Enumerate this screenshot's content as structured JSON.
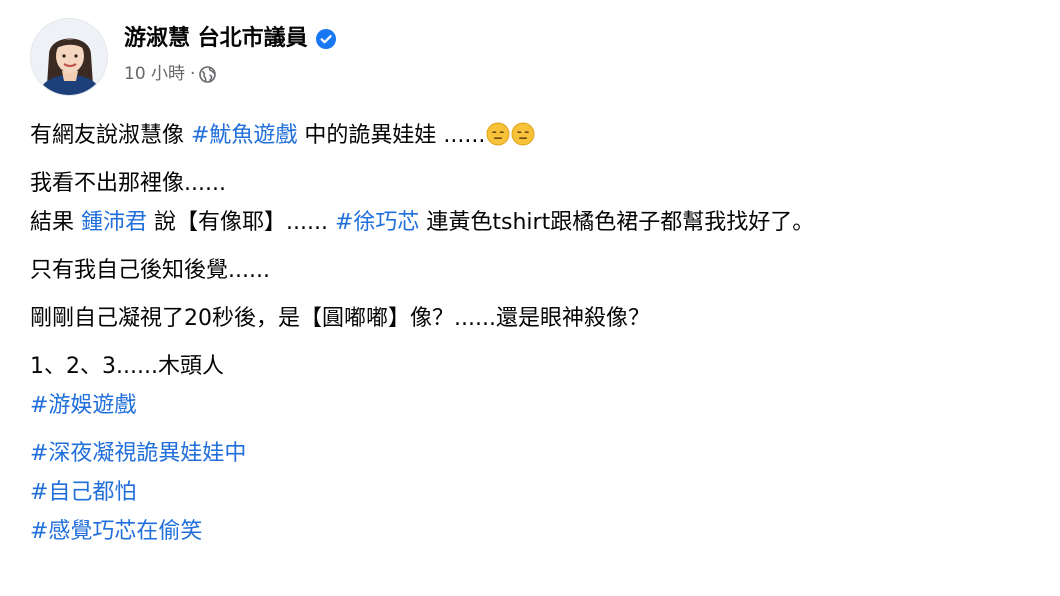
{
  "author": {
    "name": "游淑慧 台北市議員",
    "time": "10 小時",
    "separator": "·"
  },
  "post": {
    "line1": {
      "before": "有網友說淑慧像 ",
      "tag": "#魷魚遊戲",
      "after": "  中的詭異娃娃 ......"
    },
    "line2": "我看不出那裡像......",
    "line3": {
      "before": "結果 ",
      "mention1": "鍾沛君",
      "middle": "  說【有像耶】...... ",
      "mention2": "#徐巧芯",
      "after": " 連黃色tshirt跟橘色裙子都幫我找好了。"
    },
    "line4": "只有我自己後知後覺......",
    "line5": "剛剛自己凝視了20秒後，是【圓嘟嘟】像？......還是眼神殺像？",
    "line6": "1、2、3......木頭人",
    "tag1": "#游娛遊戲",
    "tag2": "#深夜凝視詭異娃娃中",
    "tag3": "#自己都怕",
    "tag4": "#感覺巧芯在偷笑"
  },
  "icons": {
    "verified": "verified-badge-icon",
    "privacy": "globe-icon",
    "emoji": "expressionless-face-emoji"
  },
  "colors": {
    "link": "#216fdb",
    "verified": "#1877f2",
    "secondary": "#65676b"
  }
}
